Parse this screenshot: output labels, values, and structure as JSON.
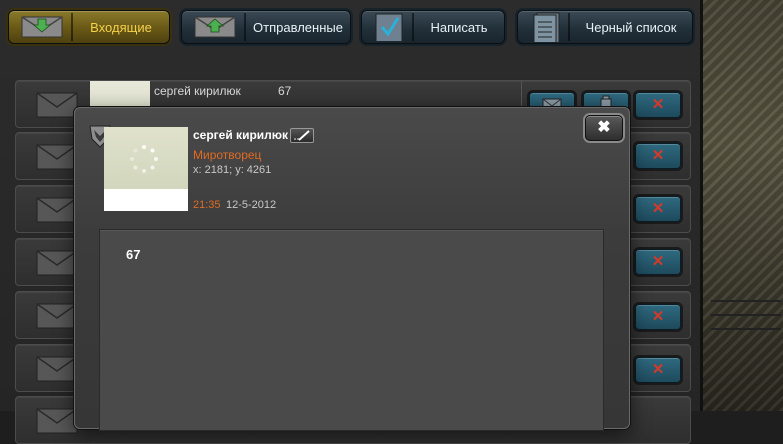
{
  "tabs": [
    {
      "label": "Входящие",
      "active": true,
      "icon": "envelope-down-icon"
    },
    {
      "label": "Отправленные",
      "active": false,
      "icon": "envelope-up-icon"
    },
    {
      "label": "Написать",
      "active": false,
      "icon": "checkbox-icon"
    },
    {
      "label": "Черный список",
      "active": false,
      "icon": "document-list-icon"
    }
  ],
  "inbox": {
    "first_row": {
      "sender": "сергей кирилюк",
      "subject": "67"
    },
    "row_count_visible": 7
  },
  "message": {
    "sender_name": "сергей кирилюк",
    "sender_rank": "Миротворец",
    "coords": "x: 2181; y: 4261",
    "time": "21:35",
    "date": "12-5-2012",
    "body": "67",
    "close_label": "✖"
  },
  "colors": {
    "accent_orange": "#e06a22",
    "active_tab_text": "#f5d24a",
    "delete_red": "#d23a2a",
    "button_teal": "#2f6a80"
  }
}
